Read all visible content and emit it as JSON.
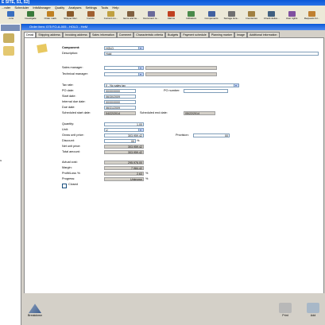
{
  "app": {
    "title": "E SITE, S1, S2)"
  },
  "menu": [
    "...nder",
    "Scheduler",
    "InfoManager",
    "Quality",
    "Analyses",
    "Settings",
    "Tools",
    "Help"
  ],
  "toolbar": [
    {
      "label": "...ions",
      "color": "#3a6fbf"
    },
    {
      "label": "Investigate",
      "color": "#3a7a3a"
    },
    {
      "label": "Order mark.",
      "color": "#c08020"
    },
    {
      "label": "Shipper Rec.",
      "color": "#8a5a2a"
    },
    {
      "label": "Invoice",
      "color": "#a06030"
    },
    {
      "label": "Current mo...",
      "color": "#c0a040"
    },
    {
      "label": "Items and ite...",
      "color": "#806040"
    },
    {
      "label": "Document re...",
      "color": "#6a6a9a"
    },
    {
      "label": "Alarms",
      "color": "#c04020"
    },
    {
      "label": "Indicators",
      "color": "#4a8a4a"
    },
    {
      "label": "Components",
      "color": "#4060a0"
    },
    {
      "label": "Storage loca...",
      "color": "#707070"
    },
    {
      "label": "Inventories",
      "color": "#a08040"
    },
    {
      "label": "Check delive...",
      "color": "#406080"
    },
    {
      "label": "User rights",
      "color": "#8050a0"
    },
    {
      "label": "Requests for...",
      "color": "#c08030"
    }
  ],
  "document": {
    "title": "Order item: 075 FO-A-005 - HOLD - HeM"
  },
  "tabs": [
    "Detail",
    "Shipping address",
    "Invoicing address",
    "Sales information",
    "Comment",
    "Characteristic criteria",
    "Budgets",
    "Payment schedule",
    "Planning marker",
    "Image",
    "Additional information"
  ],
  "form": {
    "component_label": "Component:",
    "component_value": "HOLD",
    "description_label": "Description:",
    "description_value": "Hold",
    "sales_manager_label": "Sales manager:",
    "technical_manager_label": "Technical manager:",
    "tax_rate_label": "Tax rate:",
    "tax_rate_value": "0 - No sales tax",
    "po_date_label": "PO date:",
    "po_date_value": "00/00/0000",
    "po_number_label": "PO number:",
    "start_date_label": "Start date:",
    "start_date_value": "06/30/2009",
    "internal_due_label": "Internal due date:",
    "internal_due_value": "00/00/0000",
    "due_date_label": "Due date:",
    "due_date_value": "06/31/2009",
    "sched_start_label": "Scheduled start date:",
    "sched_start_value": "04/22/2014",
    "sched_end_label": "Scheduled end date:",
    "sched_end_value": "05/22/2014",
    "quantity_label": "Quantity:",
    "quantity_value": "1.00",
    "unit_label": "Unit:",
    "unit_value": "U",
    "gross_unit_label": "Gross unit price:",
    "gross_unit_value": "303,959.42",
    "provision_label": "Provision:",
    "provision_value": "00",
    "discount_label": "Discount:",
    "discount_value": "00",
    "net_unit_label": "Net unit price:",
    "net_unit_value": "303,959.42",
    "total_amount_label": "Total amount:",
    "total_amount_value": "303,959.42",
    "actual_cost_label": "Actual cost:",
    "actual_cost_value": "295,976.00",
    "margin_label": "Margin:",
    "margin_value": "7,984.42",
    "profit_label": "Profit/Loss %:",
    "profit_value": "2.63",
    "progress_label": "Progress:",
    "progress_value": "Unknown",
    "closed_label": "Closed",
    "pct": "%"
  },
  "bottom": {
    "breakdown": "Breakdown",
    "print": "Print",
    "add": "Add"
  }
}
